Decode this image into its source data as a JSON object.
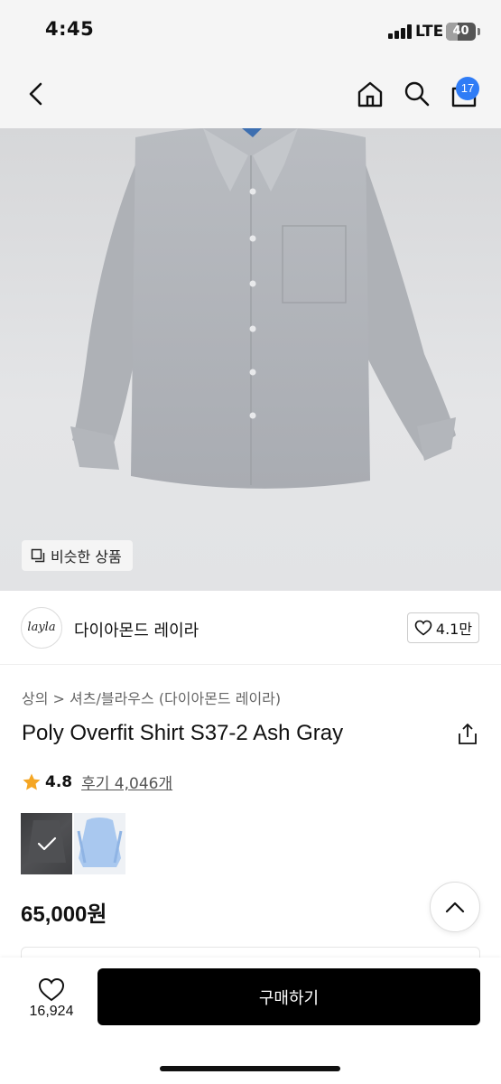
{
  "status_bar": {
    "time": "4:45",
    "network": "LTE",
    "battery": "40",
    "battery_level": 0.4
  },
  "header": {
    "cart_count": "17"
  },
  "hero": {
    "similar_products_label": "비슷한 상품"
  },
  "brand": {
    "logo_text": "layla",
    "name": "다이아몬드 레이라",
    "likes": "4.1만"
  },
  "product": {
    "breadcrumb": "상의 > 셔츠/블라우스 (다이아몬드 레이라)",
    "title": "Poly Overfit Shirt S37-2 Ash Gray",
    "rating": "4.8",
    "reviews": "후기 4,046개",
    "price": "65,000원",
    "swatches": [
      {
        "color": "ash-gray",
        "selected": true
      },
      {
        "color": "light-blue",
        "selected": false
      }
    ]
  },
  "bottom_bar": {
    "wish_count": "16,924",
    "buy_label": "구매하기"
  },
  "colors": {
    "accent": "#2f7cf6",
    "buy_button": "#000000",
    "star": "#f5a623"
  }
}
